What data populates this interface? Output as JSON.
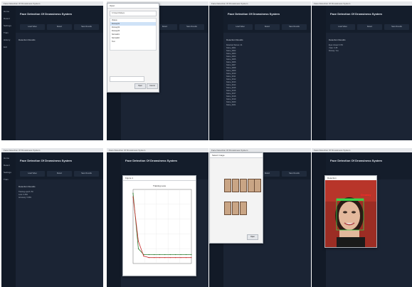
{
  "app": {
    "title": "Face Detection Of Drowsiness System",
    "window_title": "Face Detection Of Drowsiness System",
    "sidebar_items": [
      "Home",
      "Detect",
      "Settings",
      "Train",
      "History",
      "Exit"
    ],
    "tabs": [
      "Load Video",
      "Detect",
      "Save Results"
    ],
    "section_label": "Detection Results"
  },
  "panel3": {
    "lines": [
      "Detected frames: 21",
      "frame_0001",
      "frame_0002",
      "frame_0003",
      "frame_0004",
      "frame_0005",
      "frame_0006",
      "frame_0007",
      "frame_0008",
      "frame_0009",
      "frame_0010",
      "frame_0011",
      "frame_0012",
      "frame_0013",
      "frame_0014",
      "frame_0015",
      "frame_0016",
      "frame_0017",
      "frame_0018",
      "frame_0019",
      "frame_0020",
      "frame_0021"
    ]
  },
  "panel4": {
    "lines": [
      "Eyes closed: 0.53",
      "Yawn: 0.35",
      "Drowsy: Yes"
    ]
  },
  "panel5": {
    "lines": [
      "Training epoch: 50",
      "Loss: 0.052",
      "Accuracy: 0.981"
    ]
  },
  "file_dialog": {
    "title": "Open",
    "path": "C:\\Users\\Videos",
    "rows": [
      "Videos",
      "Drowsy01",
      "Drowsy02",
      "Drowsy03",
      "Normal01",
      "Normal02",
      "Test"
    ],
    "open_label": "Open",
    "cancel_label": "Cancel"
  },
  "plot_window": {
    "title": "Figure 1"
  },
  "gallery_dialog": {
    "title": "Select Image",
    "open_label": "Open"
  },
  "photo_window": {
    "title": "Detection",
    "overlay_label": "Drowsy"
  },
  "chart_data": {
    "type": "line",
    "title": "Training Loss",
    "series": [
      {
        "values": [
          0.95,
          0.2,
          0.12,
          0.12,
          0.12,
          0.12,
          0.12,
          0.12,
          0.12,
          0.12,
          0.12,
          0.12
        ]
      },
      {
        "values": [
          0.9,
          0.3,
          0.1,
          0.08,
          0.08,
          0.08,
          0.08,
          0.08,
          0.08,
          0.08,
          0.08,
          0.08
        ]
      }
    ],
    "colors": [
      "#2e7d32",
      "#c62828"
    ]
  }
}
